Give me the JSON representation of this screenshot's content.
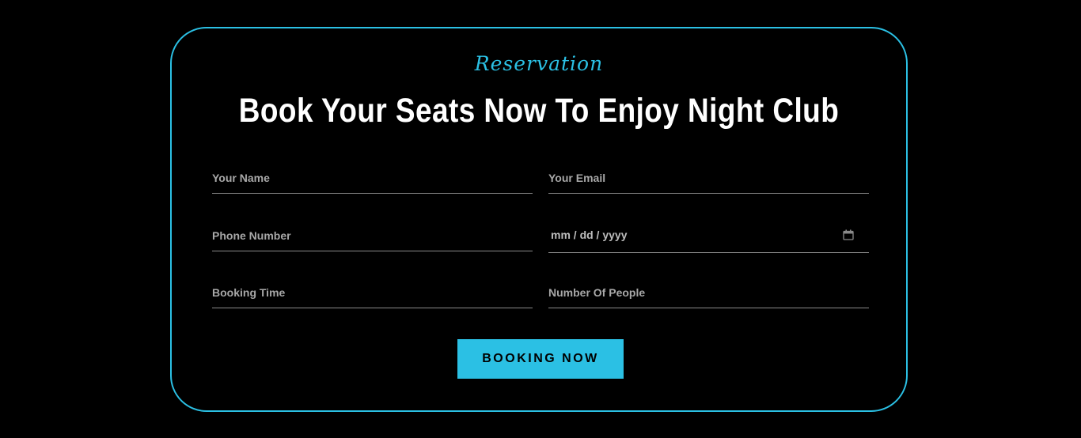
{
  "reservation": {
    "subtitle": "Reservation",
    "title": "Book Your Seats Now To Enjoy Night Club",
    "fields": {
      "name": {
        "placeholder": "Your Name"
      },
      "email": {
        "placeholder": "Your Email"
      },
      "phone": {
        "placeholder": "Phone Number"
      },
      "date": {
        "placeholder": "mm / dd / yyyy",
        "icon": "calendar-icon"
      },
      "time": {
        "placeholder": "Booking Time"
      },
      "people": {
        "placeholder": "Number Of People"
      }
    },
    "submit_label": "BOOKING NOW"
  },
  "colors": {
    "accent": "#2bc0e4",
    "background": "#000000",
    "title": "#ffffff",
    "field_text": "#a8a8a8",
    "underline": "#8a8a8a"
  }
}
